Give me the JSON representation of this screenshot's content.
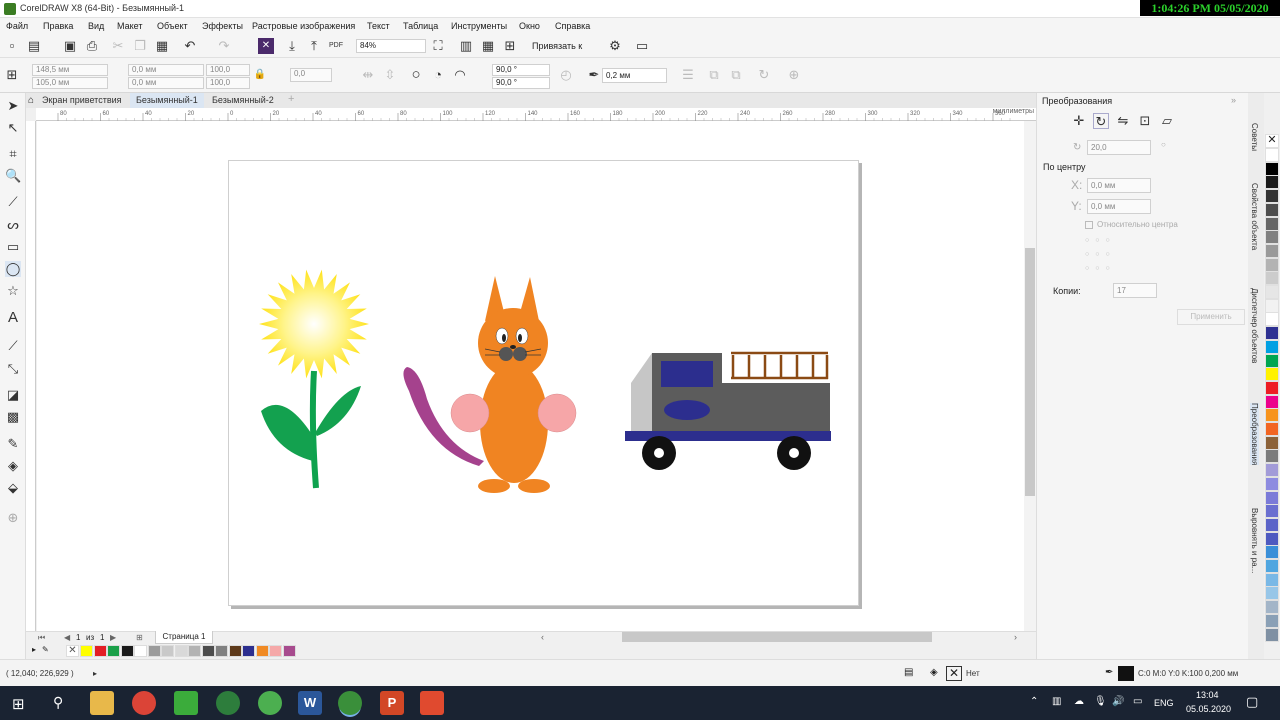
{
  "window": {
    "title": "CorelDRAW X8 (64-Bit) - Безымянный-1",
    "clock_overlay": "1:04:26 PM 05/05/2020"
  },
  "menu": [
    "Файл",
    "Правка",
    "Вид",
    "Макет",
    "Объект",
    "Эффекты",
    "Растровые изображения",
    "Текст",
    "Таблица",
    "Инструменты",
    "Окно",
    "Справка"
  ],
  "toolbar": {
    "zoom": "84%",
    "snap_label": "Привязать к"
  },
  "propbar": {
    "pos_x": "148,5 мм",
    "pos_y": "105,0 мм",
    "size_w": "0,0 мм",
    "size_h": "0,0 мм",
    "scale_x": "100,0",
    "scale_y": "100,0",
    "angle": "0,0",
    "start_angle": "90,0 °",
    "end_angle": "90,0 °",
    "outline_width": "0,2 мм"
  },
  "tabs": [
    {
      "label": "Экран приветствия"
    },
    {
      "label": "Безымянный-1"
    },
    {
      "label": "Безымянный-2"
    }
  ],
  "ruler": {
    "unit": "миллиметры",
    "ticks": [
      "80",
      "60",
      "40",
      "20",
      "0",
      "20",
      "40",
      "60",
      "80",
      "100",
      "120",
      "140",
      "160",
      "180",
      "200",
      "220",
      "240",
      "260",
      "280",
      "300",
      "320",
      "340",
      "360",
      "380",
      "400"
    ]
  },
  "pagenav": {
    "current": "1",
    "of": "из",
    "total": "1",
    "page_label": "Страница 1"
  },
  "status": {
    "coords": "( 12,040; 226,929 )",
    "fill_none": "Нет",
    "outline_info": "C:0 M:0 Y:0 K:100  0,200 мм"
  },
  "docker": {
    "title": "Преобразования",
    "angle": "20,0",
    "center_label": "По центру",
    "x_label": "X:",
    "x_value": "0,0 мм",
    "y_label": "Y:",
    "y_value": "0,0 мм",
    "relative_center": "Относительно центра",
    "copies_label": "Копии:",
    "copies_value": "17",
    "apply": "Применить"
  },
  "docker_tabs": [
    "Советы",
    "Свойства объекта",
    "Диспетчер объектов",
    "Преобразования",
    "Выровнять и ра..."
  ],
  "taskbar": {
    "lang": "ENG",
    "time": "13:04",
    "date": "05.05.2020"
  },
  "colors": {
    "accent": "#3b7d23",
    "palette_bottom": [
      "#ffff00",
      "#e31e24",
      "#1ba049",
      "#1a1a1a",
      "#ffffff",
      "#9b9b9b",
      "#c9c9c9",
      "#d9d9d9",
      "#b3b3b3",
      "#4d4d4d",
      "#808080",
      "#5e3a1a",
      "#2c2e8e",
      "#f08a24",
      "#f5a8a8",
      "#a74b8e"
    ],
    "palette_right": [
      "#ffffff",
      "#000000",
      "#1a1a1a",
      "#333333",
      "#4d4d4d",
      "#666666",
      "#808080",
      "#999999",
      "#b3b3b3",
      "#cccccc",
      "#e6e6e6",
      "#f2f2f2",
      "#ffffff",
      "#2e3192",
      "#00a0e3",
      "#00a651",
      "#fff200",
      "#ed1c24",
      "#ec008c",
      "#f7941d",
      "#f26522",
      "#8c6239",
      "#7b7b7b",
      "#a29bd8",
      "#8d8be0",
      "#7a7ad8",
      "#6a6fd0",
      "#5b64c8",
      "#4e5ac0",
      "#3a8fd8",
      "#4fa6e0",
      "#79b8e6",
      "#97c6e8",
      "#a3b5c8",
      "#8aa0b6",
      "#7f90a3"
    ]
  }
}
